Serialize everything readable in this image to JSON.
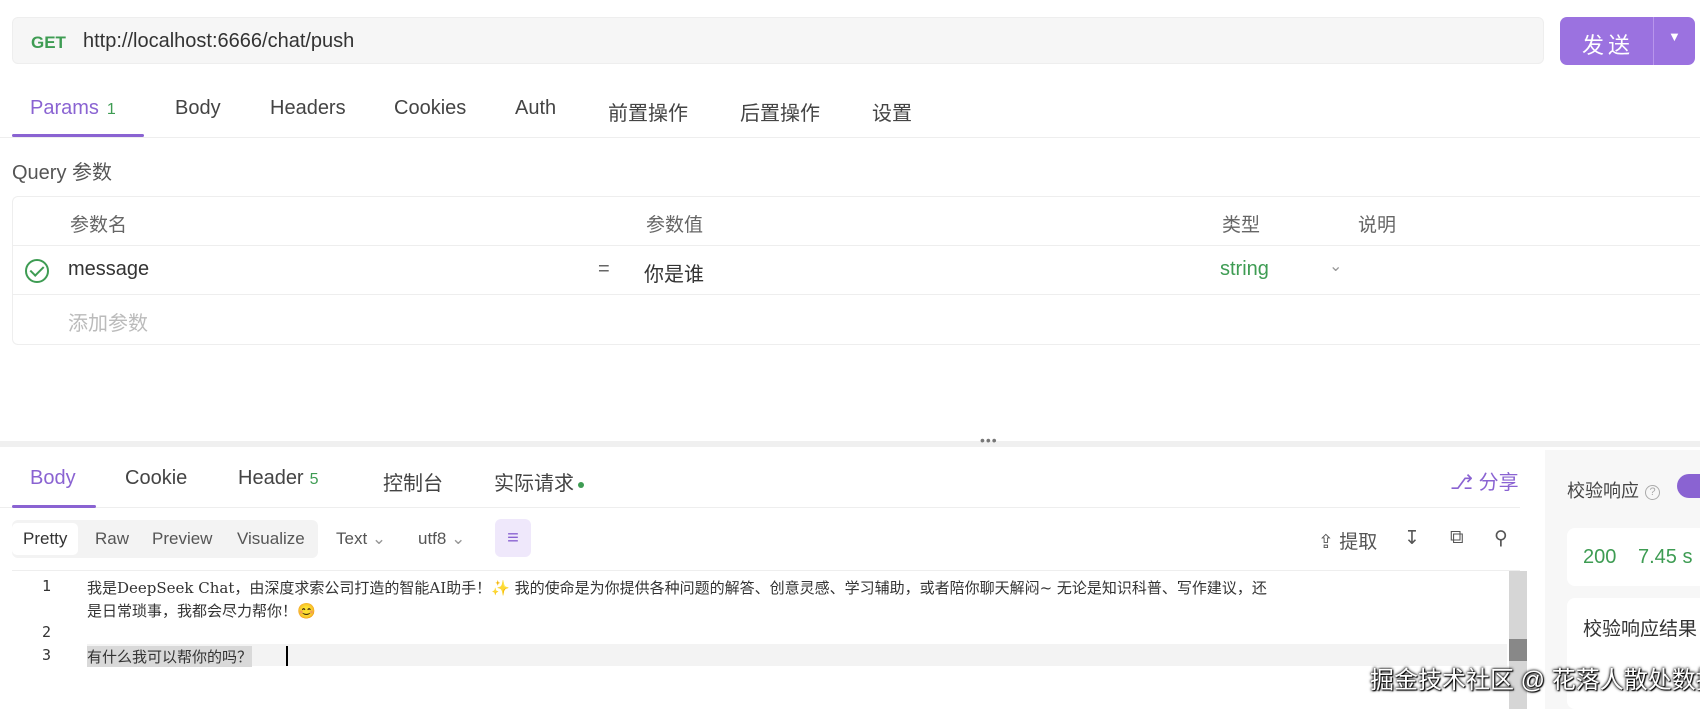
{
  "request": {
    "method": "GET",
    "url": "http://localhost:6666/chat/push",
    "send_label": "发送"
  },
  "request_tabs": [
    {
      "label": "Params",
      "badge": "1"
    },
    {
      "label": "Body"
    },
    {
      "label": "Headers"
    },
    {
      "label": "Cookies"
    },
    {
      "label": "Auth"
    },
    {
      "label": "前置操作"
    },
    {
      "label": "后置操作"
    },
    {
      "label": "设置"
    }
  ],
  "query": {
    "title": "Query 参数",
    "headers": {
      "name": "参数名",
      "value": "参数值",
      "type": "类型",
      "desc": "说明"
    },
    "rows": [
      {
        "name": "message",
        "eq": "=",
        "value": "你是谁",
        "type": "string"
      }
    ],
    "add_placeholder": "添加参数"
  },
  "response_tabs": [
    {
      "label": "Body"
    },
    {
      "label": "Cookie"
    },
    {
      "label": "Header",
      "badge": "5"
    },
    {
      "label": "控制台"
    },
    {
      "label": "实际请求"
    }
  ],
  "share_label": "分享",
  "view_modes": [
    "Pretty",
    "Raw",
    "Preview",
    "Visualize"
  ],
  "format_select": "Text",
  "encoding_select": "utf8",
  "extract_label": "提取",
  "editor": {
    "line_numbers": [
      "1",
      "2",
      "3"
    ],
    "line1a": "我是DeepSeek Chat，由深度求索公司打造的智能AI助手！✨ 我的使命是为你提供各种问题的解答、创意灵感、学习辅助，或者陪你聊天解闷~ 无论是知识科普、写作建议，还",
    "line1b": "是日常琐事，我都会尽力帮你！😊",
    "line3": "有什么我可以帮你的吗？"
  },
  "side_panel": {
    "title": "校验响应",
    "status_code": "200",
    "time": "7.45 s",
    "result_title": "校验响应结果"
  },
  "watermark": "掘金技术社区 @ 花落人散处数据",
  "colors": {
    "accent": "#8a63d2",
    "success": "#3e9c53",
    "send": "#9b72e0"
  }
}
